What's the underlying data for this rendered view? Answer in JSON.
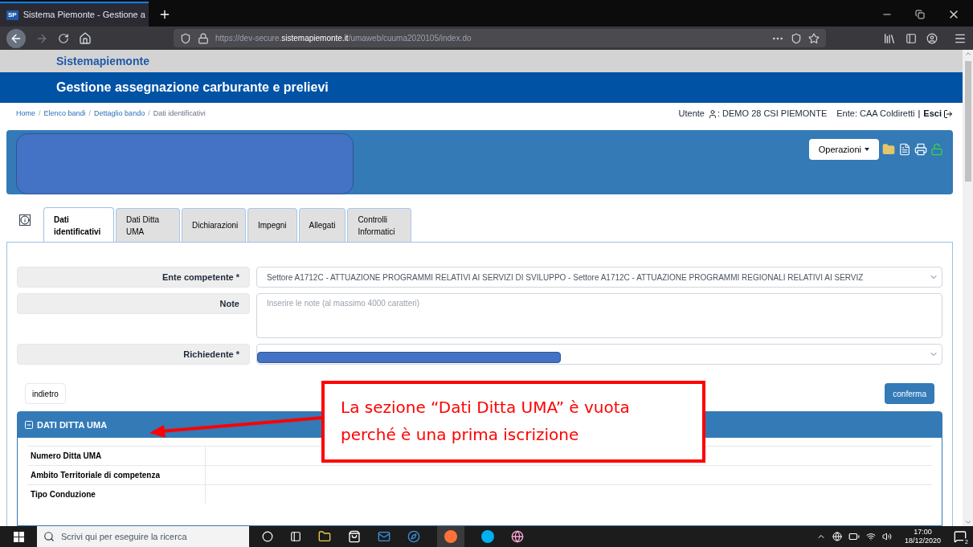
{
  "browser": {
    "tab_title": "Sistema Piemonte - Gestione a",
    "tab_logo": "SP",
    "url": {
      "prefix": "https://dev-secure.",
      "domain": "sistemapiemonte.it",
      "path": "/umaweb/cuuma2020105/index.do"
    }
  },
  "site": {
    "brand": "Sistemapiemonte",
    "title": "Gestione assegnazione carburante e prelievi"
  },
  "breadcrumb": [
    {
      "label": "Home",
      "link": true
    },
    {
      "separator": "/",
      "label": "Elenco bandi",
      "link": true
    },
    {
      "separator": "/",
      "label": "Dettaglio bando",
      "link": true
    },
    {
      "separator": "/",
      "label": "Dati identificativi",
      "link": false
    }
  ],
  "user_bar": {
    "user_label": "Utente",
    "user": ": DEMO 28 CSI PIEMONTE",
    "ente": "Ente: CAA Coldiretti",
    "divider": "|",
    "logout": "Esci"
  },
  "header_panel": {
    "operations": "Operazioni"
  },
  "tabs": [
    {
      "label": "Dati identificativi",
      "selected": true
    },
    {
      "label": "Dati Ditta UMA",
      "selected": false
    },
    {
      "label": "Dichiarazioni",
      "selected": false
    },
    {
      "label": "Impegni",
      "selected": false
    },
    {
      "label": "Allegati",
      "selected": false
    },
    {
      "label": "Controlli Informatici",
      "selected": false
    }
  ],
  "form": {
    "fields": [
      {
        "kind": "select",
        "label": "Ente competente *",
        "value": "Settore A1712C - ATTUAZIONE PROGRAMMI RELATIVI AI SERVIZI DI SVILUPPO - Settore A1712C - ATTUAZIONE PROGRAMMI REGIONALI RELATIVI AI SERVIZ"
      },
      {
        "kind": "textarea",
        "label": "Note",
        "placeholder": "Inserire le note (al massimo 4000 caratteri)"
      },
      {
        "kind": "redacted",
        "label": "Richiedente *"
      }
    ],
    "back": "indietro",
    "confirm": "conferma"
  },
  "section": {
    "title": "DATI DITTA UMA",
    "rows": [
      {
        "label": "Numero Ditta UMA"
      },
      {
        "label": "Ambito Territoriale di competenza"
      },
      {
        "label": "Tipo Conduzione"
      }
    ]
  },
  "callout": {
    "text": "La sezione “Dati Ditta UMA” è vuota perché è una prima iscrizione"
  },
  "taskbar": {
    "search_placeholder": "Scrivi qui per eseguire la ricerca",
    "time": "17:00",
    "date": "18/12/2020",
    "notifications": "2"
  }
}
